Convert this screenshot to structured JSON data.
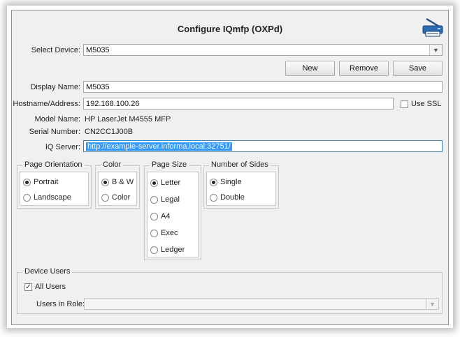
{
  "title": "Configure IQmfp (OXPd)",
  "icons": {
    "printer": "printer-icon",
    "dropdown": "chevron-down-icon",
    "check": "checkmark-icon"
  },
  "device": {
    "label": "Select Device:",
    "value": "M5035"
  },
  "buttons": {
    "new": "New",
    "remove": "Remove",
    "save": "Save"
  },
  "display_name": {
    "label": "Display Name:",
    "value": "M5035"
  },
  "hostname": {
    "label": "Hostname/Address:",
    "value": "192.168.100.26"
  },
  "use_ssl": {
    "label": "Use SSL",
    "checked": false
  },
  "model": {
    "label": "Model Name:",
    "value": "HP LaserJet M4555 MFP"
  },
  "serial": {
    "label": "Serial Number:",
    "value": "CN2CC1J00B"
  },
  "iq_server": {
    "label": "IQ Server:",
    "value": "http://example-server.informa.local:32751/"
  },
  "orientation": {
    "title": "Page Orientation",
    "options": [
      "Portrait",
      "Landscape"
    ],
    "selected": "Portrait"
  },
  "color": {
    "title": "Color",
    "options": [
      "B & W",
      "Color"
    ],
    "selected": "B & W"
  },
  "page_size": {
    "title": "Page Size",
    "options": [
      "Letter",
      "Legal",
      "A4",
      "Exec",
      "Ledger"
    ],
    "selected": "Letter"
  },
  "sides": {
    "title": "Number of Sides",
    "options": [
      "Single",
      "Double"
    ],
    "selected": "Single"
  },
  "device_users": {
    "title": "Device Users",
    "all_users_label": "All Users",
    "all_users_checked": true,
    "users_in_role_label": "Users in Role:",
    "users_in_role_value": ""
  }
}
